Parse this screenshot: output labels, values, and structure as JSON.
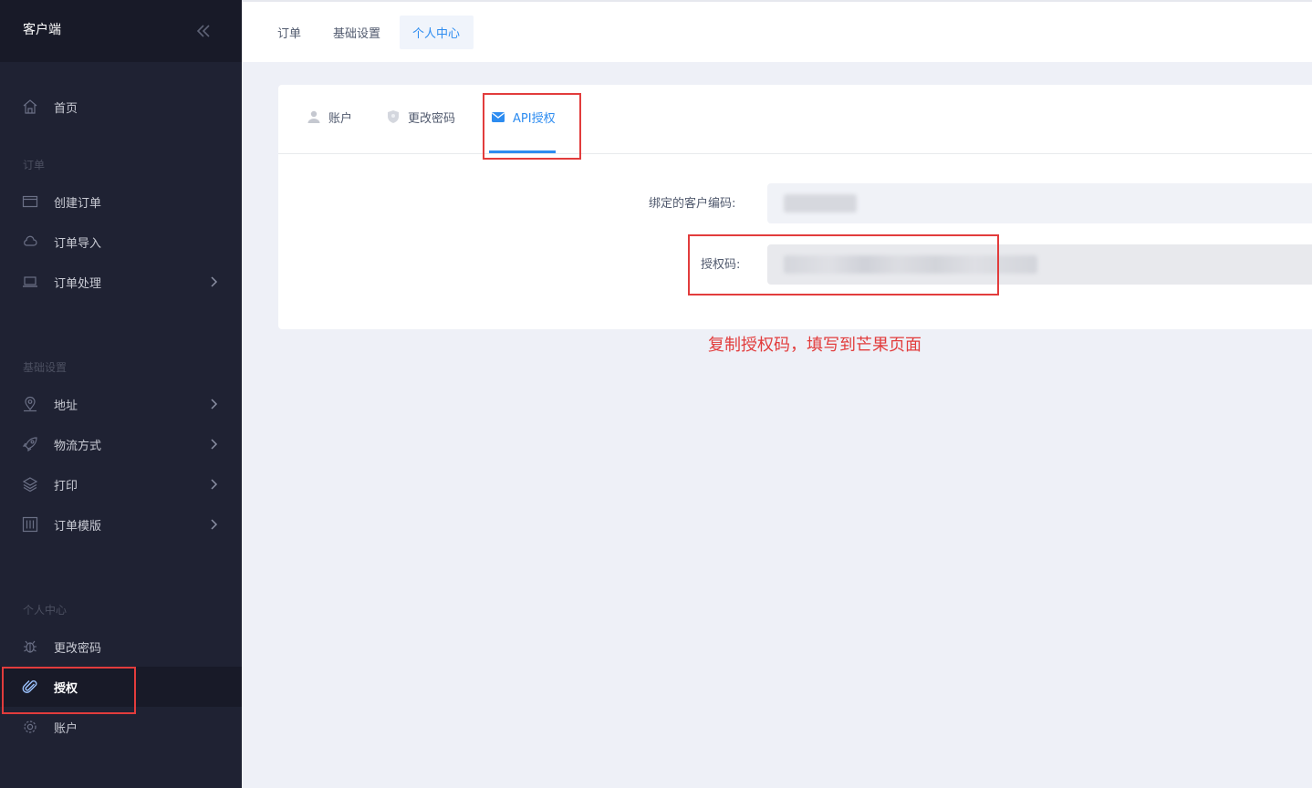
{
  "sidebar": {
    "title": "客户端",
    "home": "首页",
    "sections": {
      "orders": "订单",
      "basic": "基础设置",
      "personal": "个人中心"
    },
    "items": {
      "create_order": "创建订单",
      "import_order": "订单导入",
      "process_order": "订单处理",
      "address": "地址",
      "logistics": "物流方式",
      "print": "打印",
      "template": "订单模版",
      "change_password": "更改密码",
      "authorize": "授权",
      "account": "账户"
    }
  },
  "top_tabs": [
    "订单",
    "基础设置",
    "个人中心"
  ],
  "card": {
    "tabs": [
      "账户",
      "更改密码",
      "API授权"
    ],
    "fields": {
      "customer_code_label": "绑定的客户编码:",
      "auth_code_label": "授权码:"
    }
  },
  "annotation": "复制授权码，填写到芒果页面",
  "colors": {
    "sidebar_bg": "#1f2233",
    "accent": "#2d8cf0",
    "annotation_red": "#e23c3c"
  },
  "icons": {
    "collapse": "double-chevron-left-icon",
    "home": "home-icon",
    "create_order": "card-icon",
    "import_order": "cloud-icon",
    "process_order": "laptop-icon",
    "address": "location-pin-icon",
    "logistics": "rocket-icon",
    "print": "layers-icon",
    "template": "columns-icon",
    "change_password": "bug-icon",
    "authorize": "paperclip-icon",
    "account": "gear-icon",
    "tab_account": "user-icon",
    "tab_password": "shield-icon",
    "tab_api": "envelope-icon"
  }
}
